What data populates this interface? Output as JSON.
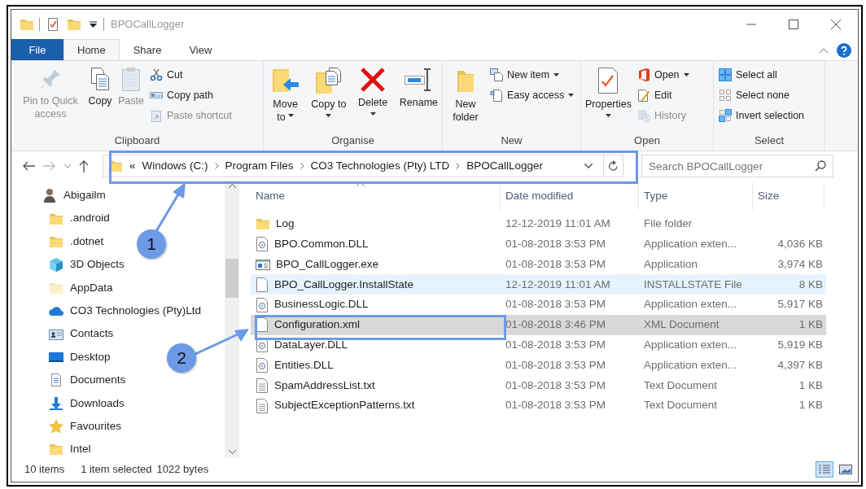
{
  "window": {
    "title": "BPOCallLogger"
  },
  "ribbon_tabs": [
    {
      "label": "File",
      "kind": "file",
      "selected": false
    },
    {
      "label": "Home",
      "kind": "tab",
      "selected": true
    },
    {
      "label": "Share",
      "kind": "tab",
      "selected": false
    },
    {
      "label": "View",
      "kind": "tab",
      "selected": false
    }
  ],
  "ribbon_groups": [
    {
      "label": "Clipboard",
      "commands": [
        {
          "label": "Pin to Quick access",
          "kind": "large",
          "disabled": true,
          "dropdown": false
        },
        {
          "label": "Copy",
          "kind": "large",
          "disabled": false,
          "dropdown": false
        },
        {
          "label": "Paste",
          "kind": "large",
          "disabled": true,
          "dropdown": false
        },
        {
          "label": "Cut",
          "kind": "small",
          "disabled": false,
          "dropdown": false
        },
        {
          "label": "Copy path",
          "kind": "small",
          "disabled": false,
          "dropdown": false
        },
        {
          "label": "Paste shortcut",
          "kind": "small",
          "disabled": true,
          "dropdown": false
        }
      ]
    },
    {
      "label": "Organise",
      "commands": [
        {
          "label": "Move to",
          "kind": "large",
          "disabled": false,
          "dropdown": true
        },
        {
          "label": "Copy to",
          "kind": "large",
          "disabled": false,
          "dropdown": true
        },
        {
          "label": "Delete",
          "kind": "large",
          "disabled": false,
          "dropdown": true
        },
        {
          "label": "Rename",
          "kind": "large",
          "disabled": false,
          "dropdown": false
        }
      ]
    },
    {
      "label": "New",
      "commands": [
        {
          "label": "New folder",
          "kind": "large",
          "disabled": false,
          "dropdown": false
        },
        {
          "label": "New item",
          "kind": "small",
          "disabled": false,
          "dropdown": true
        },
        {
          "label": "Easy access",
          "kind": "small",
          "disabled": false,
          "dropdown": true
        }
      ]
    },
    {
      "label": "Open",
      "commands": [
        {
          "label": "Properties",
          "kind": "large",
          "disabled": false,
          "dropdown": true
        },
        {
          "label": "Open",
          "kind": "small",
          "disabled": false,
          "dropdown": true
        },
        {
          "label": "Edit",
          "kind": "small",
          "disabled": false,
          "dropdown": false
        },
        {
          "label": "History",
          "kind": "small",
          "disabled": true,
          "dropdown": false
        }
      ]
    },
    {
      "label": "Select",
      "commands": [
        {
          "label": "Select all",
          "kind": "small",
          "disabled": false,
          "dropdown": false
        },
        {
          "label": "Select none",
          "kind": "small",
          "disabled": false,
          "dropdown": false
        },
        {
          "label": "Invert selection",
          "kind": "small",
          "disabled": false,
          "dropdown": false
        }
      ]
    }
  ],
  "address_bar": {
    "overflow": "«",
    "path": [
      "Windows (C:)",
      "Program Files",
      "CO3 Technologies (Pty) LTD",
      "BPOCallLogger"
    ]
  },
  "search": {
    "placeholder": "Search BPOCallLogger"
  },
  "navigation_pane": {
    "items": [
      {
        "label": "Abigailm",
        "children": [
          {
            "label": ".android"
          },
          {
            "label": ".dotnet"
          },
          {
            "label": "3D Objects"
          },
          {
            "label": "AppData"
          },
          {
            "label": "CO3 Technologies (Pty)Ltd"
          },
          {
            "label": "Contacts"
          },
          {
            "label": "Desktop"
          },
          {
            "label": "Documents"
          },
          {
            "label": "Downloads"
          },
          {
            "label": "Favourites"
          },
          {
            "label": "Intel"
          }
        ]
      }
    ]
  },
  "file_list": {
    "columns": [
      "Name",
      "Date modified",
      "Type",
      "Size"
    ],
    "rows": [
      {
        "name": "Log",
        "date_modified": "12-12-2019 11:01 AM",
        "type": "File folder",
        "kind": "folder",
        "selected": false,
        "hovered": false
      },
      {
        "name": "BPO.Common.DLL",
        "date_modified": "01-08-2018 3:53 PM",
        "type": "Application exten...",
        "size": "4,036 KB",
        "kind": "dll",
        "selected": false,
        "hovered": false
      },
      {
        "name": "BPO_CallLogger.exe",
        "date_modified": "01-08-2018 3:53 PM",
        "type": "Application",
        "size": "3,974 KB",
        "kind": "exe",
        "selected": false,
        "hovered": false
      },
      {
        "name": "BPO_CallLogger.InstallState",
        "date_modified": "12-12-2019 11:01 AM",
        "type": "INSTALLSTATE File",
        "size": "8 KB",
        "kind": "file",
        "selected": false,
        "hovered": true
      },
      {
        "name": "BusinessLogic.DLL",
        "date_modified": "01-08-2018 3:53 PM",
        "type": "Application exten...",
        "size": "5,917 KB",
        "kind": "dll",
        "selected": false,
        "hovered": false
      },
      {
        "name": "Configuration.xml",
        "date_modified": "01-08-2018 3:46 PM",
        "type": "XML Document",
        "size": "1 KB",
        "kind": "file",
        "selected": true,
        "hovered": false
      },
      {
        "name": "DataLayer.DLL",
        "date_modified": "01-08-2018 3:53 PM",
        "type": "Application exten...",
        "size": "5,919 KB",
        "kind": "dll",
        "selected": false,
        "hovered": false
      },
      {
        "name": "Entities.DLL",
        "date_modified": "01-08-2018 3:53 PM",
        "type": "Application exten...",
        "size": "4,397 KB",
        "kind": "dll",
        "selected": false,
        "hovered": false
      },
      {
        "name": "SpamAddressList.txt",
        "date_modified": "01-08-2018 3:53 PM",
        "type": "Text Document",
        "size": "1 KB",
        "kind": "txt",
        "selected": false,
        "hovered": false
      },
      {
        "name": "SubjectExceptionPatterns.txt",
        "date_modified": "01-08-2018 3:53 PM",
        "type": "Text Document",
        "size": "1 KB",
        "kind": "txt",
        "selected": false,
        "hovered": false
      }
    ]
  },
  "status_bar": {
    "item_count": "10 items",
    "selection": "1 item selected",
    "selection_size": "1022 bytes"
  },
  "view_buttons": [
    {
      "kind": "details",
      "selected": true
    },
    {
      "kind": "large_icons",
      "selected": false
    }
  ],
  "annotations": [
    {
      "label": "1"
    },
    {
      "label": "2"
    }
  ]
}
